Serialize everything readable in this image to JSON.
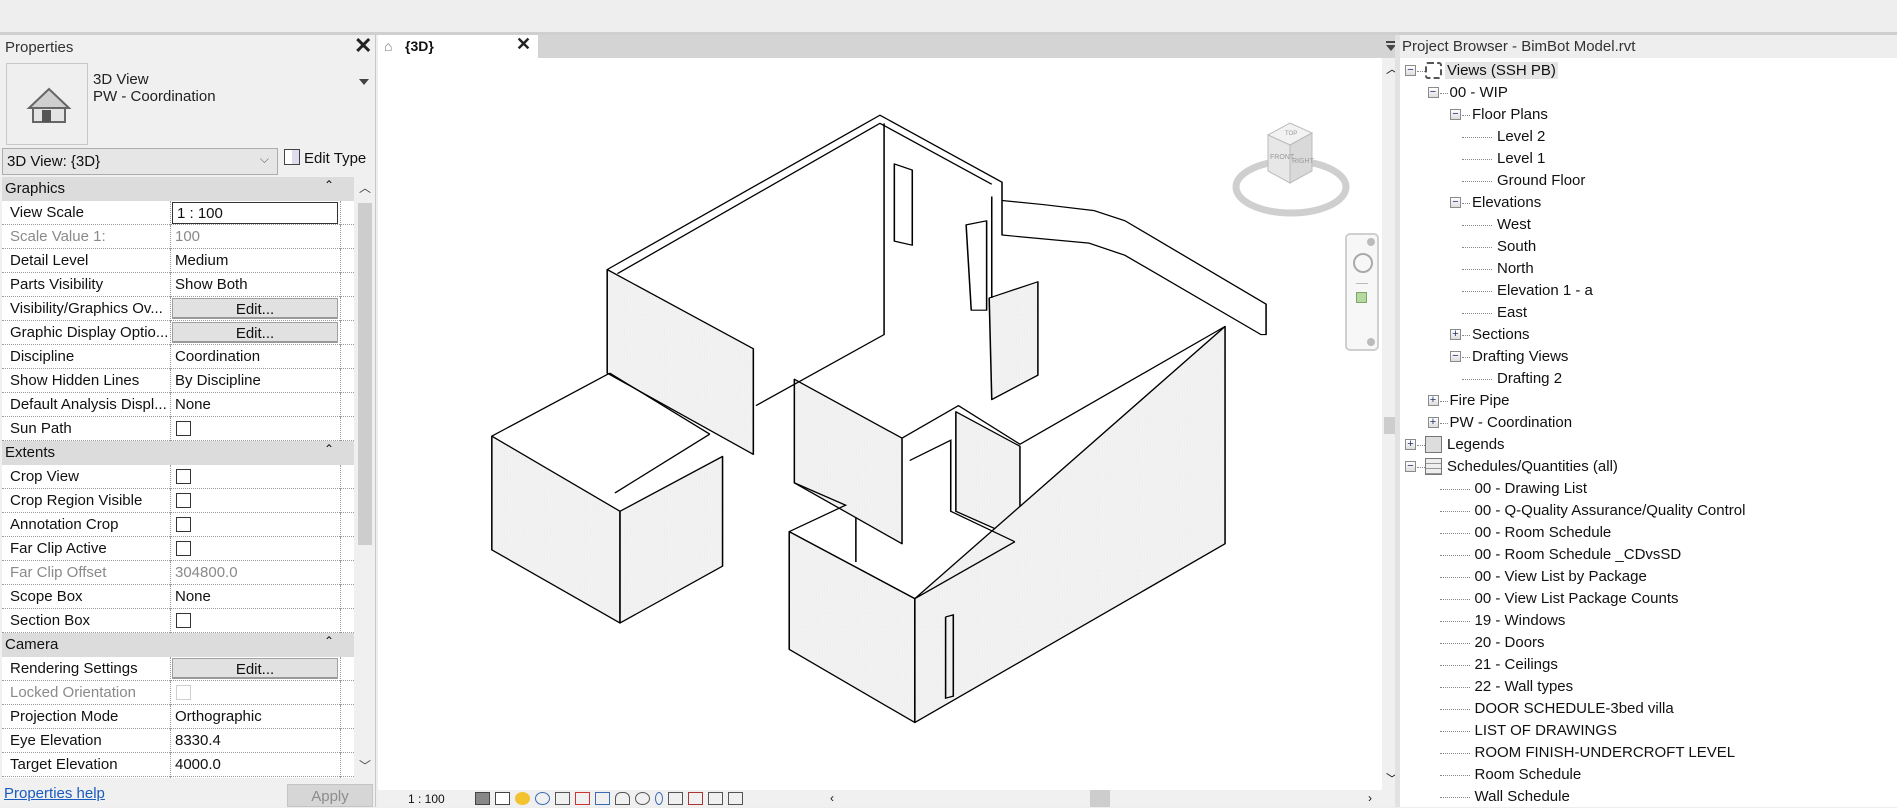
{
  "properties": {
    "title": "Properties",
    "type_family": "3D View",
    "type_name": "PW - Coordination",
    "instance_selector": "3D View: {3D}",
    "edit_type": "Edit Type",
    "rows": [
      {
        "kind": "header",
        "label": "Graphics"
      },
      {
        "kind": "input",
        "label": "View Scale",
        "value": "1 : 100"
      },
      {
        "kind": "text",
        "label": "Scale Value    1:",
        "value": "100",
        "disabled": true
      },
      {
        "kind": "text",
        "label": "Detail Level",
        "value": "Medium"
      },
      {
        "kind": "text",
        "label": "Parts Visibility",
        "value": "Show Both"
      },
      {
        "kind": "button",
        "label": "Visibility/Graphics Ov...",
        "value": "Edit..."
      },
      {
        "kind": "button",
        "label": "Graphic Display Optio...",
        "value": "Edit..."
      },
      {
        "kind": "text",
        "label": "Discipline",
        "value": "Coordination"
      },
      {
        "kind": "text",
        "label": "Show Hidden Lines",
        "value": "By Discipline"
      },
      {
        "kind": "text",
        "label": "Default Analysis Displ...",
        "value": "None"
      },
      {
        "kind": "check",
        "label": "Sun Path",
        "checked": false
      },
      {
        "kind": "header",
        "label": "Extents"
      },
      {
        "kind": "check",
        "label": "Crop View",
        "checked": false
      },
      {
        "kind": "check",
        "label": "Crop Region Visible",
        "checked": false
      },
      {
        "kind": "check",
        "label": "Annotation Crop",
        "checked": false
      },
      {
        "kind": "check",
        "label": "Far Clip Active",
        "checked": false
      },
      {
        "kind": "text",
        "label": "Far Clip Offset",
        "value": "304800.0",
        "disabled": true
      },
      {
        "kind": "text",
        "label": "Scope Box",
        "value": "None"
      },
      {
        "kind": "check",
        "label": "Section Box",
        "checked": false
      },
      {
        "kind": "header",
        "label": "Camera"
      },
      {
        "kind": "button",
        "label": "Rendering Settings",
        "value": "Edit..."
      },
      {
        "kind": "check",
        "label": "Locked Orientation",
        "checked": false,
        "disabled": true
      },
      {
        "kind": "text",
        "label": "Projection Mode",
        "value": "Orthographic"
      },
      {
        "kind": "text",
        "label": "Eye Elevation",
        "value": "8330.4"
      },
      {
        "kind": "text",
        "label": "Target Elevation",
        "value": "4000.0"
      },
      {
        "kind": "text",
        "label": "",
        "value": ""
      }
    ],
    "help_link": "Properties help",
    "apply": "Apply"
  },
  "view": {
    "tab_label": "{3D}",
    "scale": "1 : 100",
    "viewcube": {
      "top": "TOP",
      "front": "FRONT",
      "right": "RIGHT"
    }
  },
  "project_browser": {
    "title": "Project Browser - BimBot Model.rvt",
    "items": [
      {
        "level": 0,
        "toggle": "-",
        "icon": "views",
        "label": "Views (SSH PB)",
        "selected": true
      },
      {
        "level": 1,
        "toggle": "-",
        "label": "00 - WIP"
      },
      {
        "level": 2,
        "toggle": "-",
        "label": "Floor Plans"
      },
      {
        "level": 2,
        "label": "Level 2"
      },
      {
        "level": 2,
        "label": "Level 1"
      },
      {
        "level": 2,
        "label": "Ground Floor"
      },
      {
        "level": 2,
        "toggle": "-",
        "label": "Elevations"
      },
      {
        "level": 2,
        "label": "West"
      },
      {
        "level": 2,
        "label": "South"
      },
      {
        "level": 2,
        "label": "North"
      },
      {
        "level": 2,
        "label": "Elevation 1 - a"
      },
      {
        "level": 2,
        "label": "East"
      },
      {
        "level": 2,
        "toggle": "+",
        "label": "Sections"
      },
      {
        "level": 2,
        "toggle": "-",
        "label": "Drafting Views"
      },
      {
        "level": 2,
        "label": "Drafting 2"
      },
      {
        "level": 1,
        "toggle": "+",
        "label": "Fire Pipe"
      },
      {
        "level": 1,
        "toggle": "+",
        "label": "PW - Coordination"
      },
      {
        "level": 0,
        "toggle": "+",
        "icon": "legend",
        "label": "Legends"
      },
      {
        "level": 0,
        "toggle": "-",
        "icon": "schedule",
        "label": "Schedules/Quantities (all)"
      },
      {
        "level": 1,
        "label": "00 - Drawing List"
      },
      {
        "level": 1,
        "label": "00 - Q-Quality Assurance/Quality Control"
      },
      {
        "level": 1,
        "label": "00 - Room Schedule"
      },
      {
        "level": 1,
        "label": "00 - Room Schedule _CDvsSD"
      },
      {
        "level": 1,
        "label": "00 - View List by Package"
      },
      {
        "level": 1,
        "label": "00 - View List Package Counts"
      },
      {
        "level": 1,
        "label": "19 - Windows"
      },
      {
        "level": 1,
        "label": "20 - Doors"
      },
      {
        "level": 1,
        "label": "21 - Ceilings"
      },
      {
        "level": 1,
        "label": "22 - Wall types"
      },
      {
        "level": 1,
        "label": "DOOR SCHEDULE-3bed villa"
      },
      {
        "level": 1,
        "label": "LIST OF DRAWINGS"
      },
      {
        "level": 1,
        "label": "ROOM FINISH-UNDERCROFT LEVEL"
      },
      {
        "level": 1,
        "label": "Room Schedule"
      },
      {
        "level": 1,
        "label": "Wall Schedule"
      }
    ]
  },
  "colors": {
    "link": "#1a5bbf",
    "header_row": "#dcdcdc",
    "selected": "#e5e5e5"
  }
}
